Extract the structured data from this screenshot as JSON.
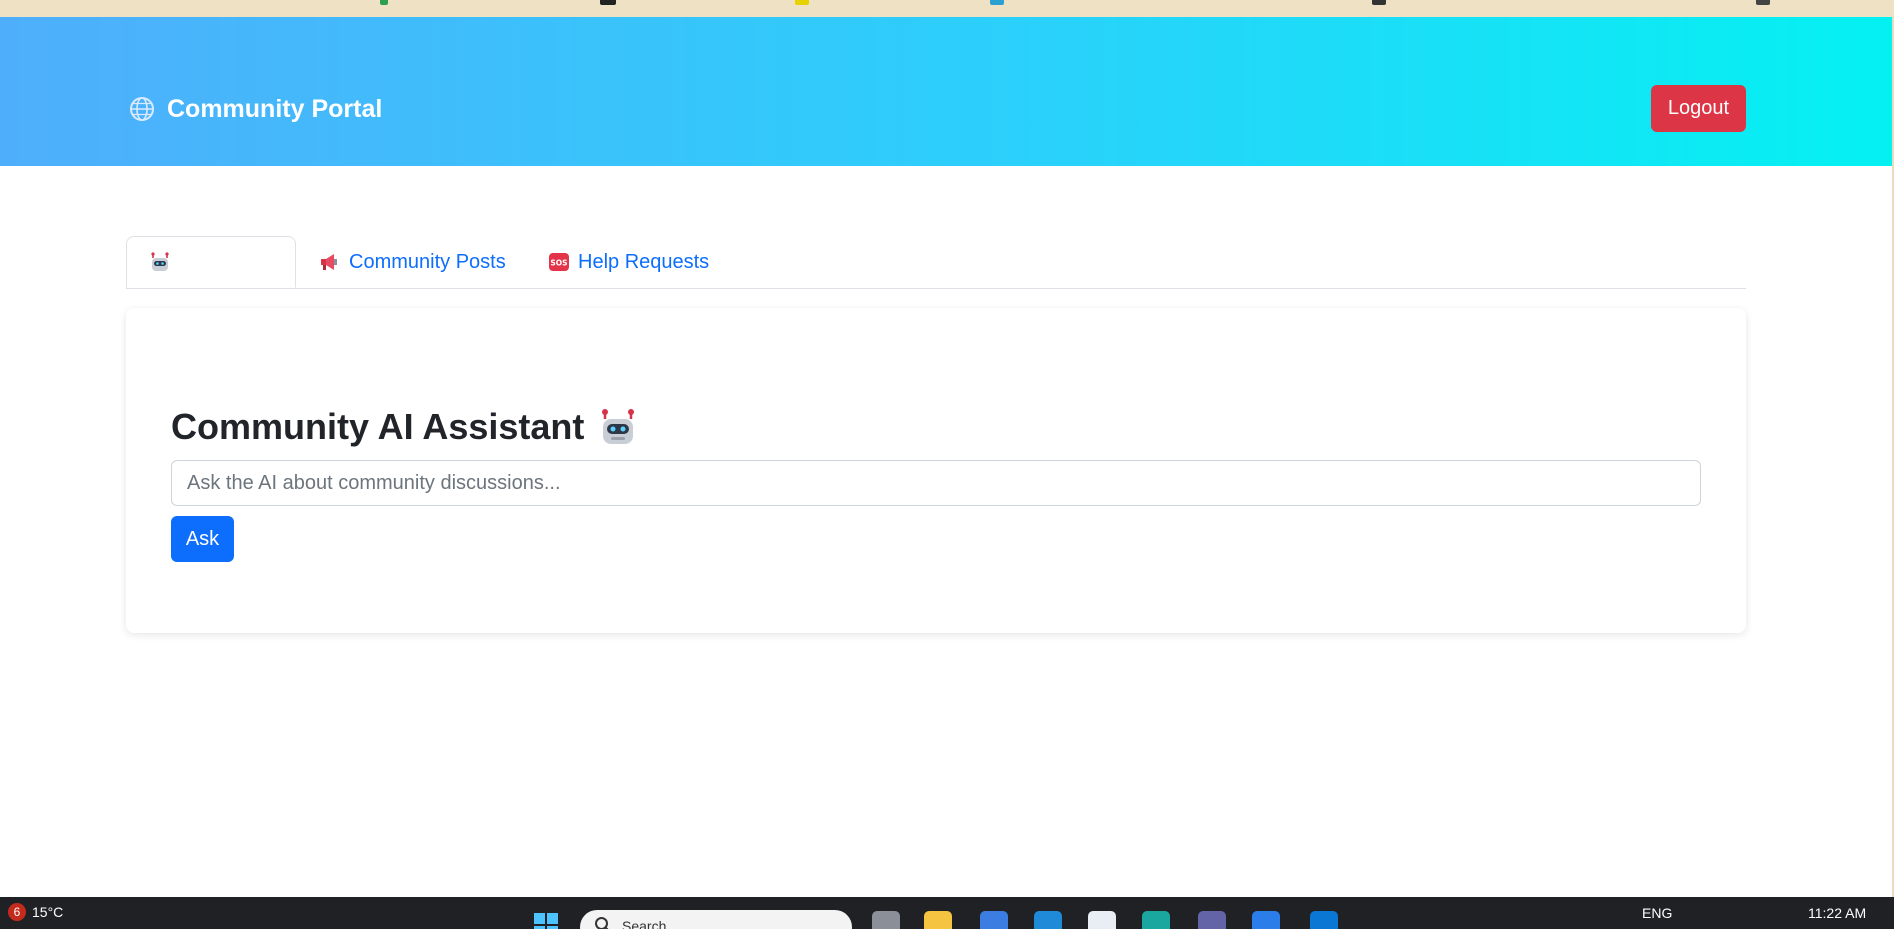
{
  "app": {
    "brand": "Community Portal",
    "logout_label": "Logout"
  },
  "tabs": [
    {
      "label": "",
      "icon": "robot-icon",
      "active": true
    },
    {
      "label": "Community Posts",
      "icon": "megaphone-icon",
      "active": false
    },
    {
      "label": "Help Requests",
      "icon": "sos-icon",
      "active": false
    }
  ],
  "assistant": {
    "title": "Community AI Assistant",
    "input_placeholder": "Ask the AI about community discussions...",
    "input_value": "",
    "ask_label": "Ask"
  },
  "taskbar": {
    "notification_count": "6",
    "temperature": "15°C",
    "search_text": "Search",
    "language": "ENG",
    "time": "11:22 AM"
  },
  "colors": {
    "navbar_gradient_start": "#4faefb",
    "navbar_gradient_end": "#04f1f2",
    "logout": "#dc3545",
    "primary": "#0d6efd",
    "link": "#0d6efd"
  }
}
